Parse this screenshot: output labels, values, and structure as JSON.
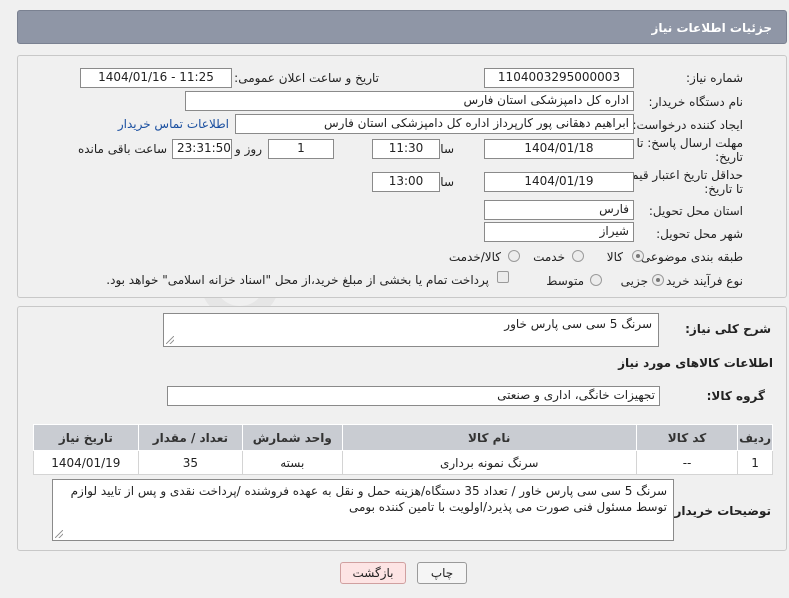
{
  "header": {
    "title": "جزئیات اطلاعات نیاز"
  },
  "form": {
    "need_number": {
      "label": "شماره نیاز:",
      "value": "1104003295000003"
    },
    "announce_datetime": {
      "label": "تاریخ و ساعت اعلان عمومی:",
      "value": "1404/01/16 - 11:25"
    },
    "buyer_org": {
      "label": "نام دستگاه خریدار:",
      "value": "اداره کل دامپزشکی استان فارس"
    },
    "requester": {
      "label": "ایجاد کننده درخواست:",
      "value": "ابراهیم دهقانی پور کارپرداز اداره کل دامپزشکی استان فارس",
      "contact_link": "اطلاعات تماس خریدار"
    },
    "reply_deadline": {
      "label": "مهلت ارسال پاسخ: تا تاریخ:",
      "date": "1404/01/18",
      "time_label": "ساعت",
      "time": "11:30",
      "days": "1",
      "days_label": "روز و",
      "remaining": "23:31:50",
      "remaining_label": "ساعت باقی مانده"
    },
    "price_validity": {
      "label": "حداقل تاریخ اعتبار قیمت: تا تاریخ:",
      "date": "1404/01/19",
      "time_label": "ساعت",
      "time": "13:00"
    },
    "delivery_province": {
      "label": "استان محل تحویل:",
      "value": "فارس"
    },
    "delivery_city": {
      "label": "شهر محل تحویل:",
      "value": "شیراز"
    },
    "category": {
      "label": "طبقه بندی موضوعی:",
      "options": [
        "کالا",
        "خدمت",
        "کالا/خدمت"
      ],
      "selected": "کالا"
    },
    "purchase_type": {
      "label": "نوع فرآیند خرید :",
      "options": [
        "جزیی",
        "متوسط"
      ],
      "selected": "جزیی",
      "payment_note": "پرداخت تمام یا بخشی از مبلغ خرید،از محل \"اسناد خزانه اسلامی\" خواهد بود."
    }
  },
  "description": {
    "label": "شرح کلی نیاز:",
    "value": "سرنگ 5 سی سی پارس خاور"
  },
  "goods_info": {
    "title": "اطلاعات کالاهای مورد نیاز",
    "group_label": "گروه کالا:",
    "group_value": "تجهیزات خانگی، اداری و صنعتی"
  },
  "table": {
    "headers": [
      "ردیف",
      "کد کالا",
      "نام کالا",
      "واحد شمارش",
      "تعداد / مقدار",
      "تاریخ نیاز"
    ],
    "rows": [
      [
        "1",
        "--",
        "سرنگ نمونه برداری",
        "بسته",
        "35",
        "1404/01/19"
      ]
    ]
  },
  "buyer_notes": {
    "label": "توضیحات خریدار:",
    "value": "سرنگ 5 سی سی پارس خاور / تعداد 35 دستگاه/هزینه حمل و نقل به عهده فروشنده /پرداخت نقدی و پس از تایید لوازم توسط مسئول فنی صورت  می پذیرد/اولویت با تامین کننده بومی"
  },
  "buttons": {
    "print": "چاپ",
    "back": "بازگشت"
  },
  "watermark": "AriaTender.neT"
}
